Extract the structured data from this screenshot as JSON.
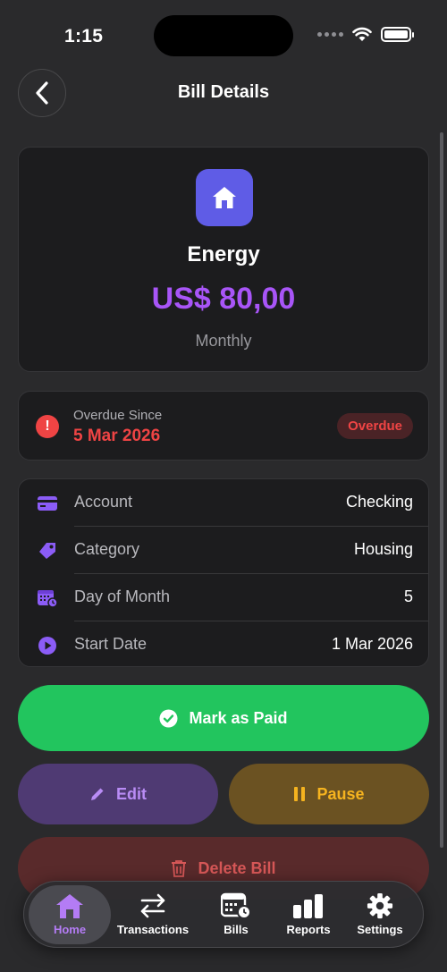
{
  "status_bar": {
    "time": "1:15"
  },
  "nav": {
    "title": "Bill Details"
  },
  "bill": {
    "icon": "house-icon",
    "name": "Energy",
    "amount": "US$ 80,00",
    "frequency": "Monthly"
  },
  "overdue": {
    "label": "Overdue Since",
    "date": "5 Mar 2026",
    "badge": "Overdue"
  },
  "details": [
    {
      "icon": "credit-card-icon",
      "label": "Account",
      "value": "Checking"
    },
    {
      "icon": "tag-icon",
      "label": "Category",
      "value": "Housing"
    },
    {
      "icon": "calendar-clock-icon",
      "label": "Day of Month",
      "value": "5"
    },
    {
      "icon": "play-circle-icon",
      "label": "Start Date",
      "value": "1 Mar 2026"
    }
  ],
  "actions": {
    "mark_paid": "Mark as Paid",
    "edit": "Edit",
    "pause": "Pause",
    "delete": "Delete Bill"
  },
  "tabs": [
    {
      "label": "Home",
      "icon": "home-icon",
      "selected": true
    },
    {
      "label": "Transactions",
      "icon": "arrows-swap-icon",
      "selected": false
    },
    {
      "label": "Bills",
      "icon": "calendar-clock-icon",
      "selected": false
    },
    {
      "label": "Reports",
      "icon": "bar-chart-icon",
      "selected": false
    },
    {
      "label": "Settings",
      "icon": "gear-icon",
      "selected": false
    }
  ],
  "colors": {
    "background": "#2a2a2c",
    "card": "#1c1c1e",
    "accent_purple": "#a855f7",
    "icon_bg": "#5f5ce6",
    "overdue_red": "#ef4444",
    "paid_green": "#22c55e",
    "pause_amber": "#f5b31f"
  }
}
